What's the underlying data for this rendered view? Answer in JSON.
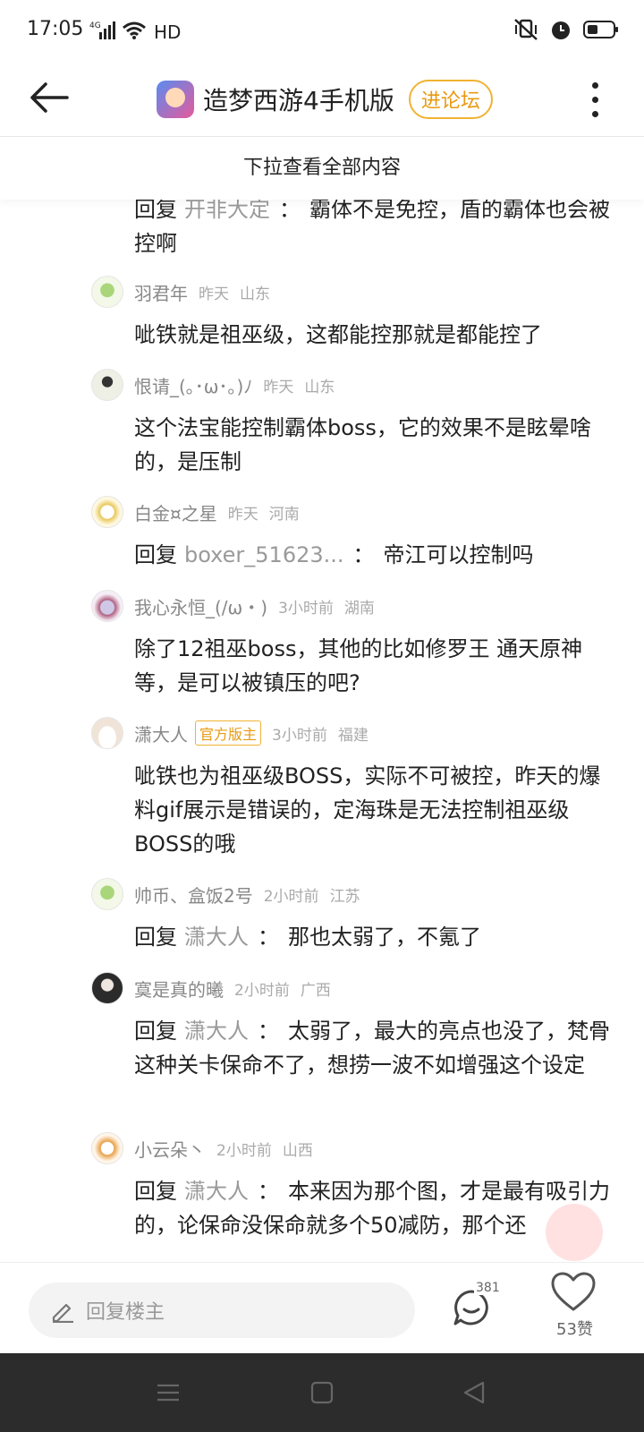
{
  "status_bar": {
    "time": "17:05",
    "network_label": "4G",
    "quality_label": "HD"
  },
  "nav": {
    "title": "造梦西游4手机版",
    "forum_button": "进论坛"
  },
  "pull_hint": "下拉查看全部内容",
  "comments": [
    {
      "type": "reply",
      "reply_word": "回复",
      "reply_target": "开非大定",
      "text": "霸体不是免控，盾的霸体也会被控啊"
    },
    {
      "type": "comment",
      "user": "羽君年",
      "time": "昨天",
      "region": "山东",
      "text": "呲铁就是祖巫级，这都能控那就是都能控了"
    },
    {
      "type": "comment",
      "user": "恨请_(｡･ω･｡)ﾉ",
      "time": "昨天",
      "region": "山东",
      "text": "这个法宝能控制霸体boss，它的效果不是眩晕啥的，是压制"
    },
    {
      "type": "comment",
      "user": "白金¤之星",
      "time": "昨天",
      "region": "河南",
      "reply_word": "回复",
      "reply_target": "boxer_51623...",
      "text": "帝江可以控制吗"
    },
    {
      "type": "comment",
      "user": "我心永恒_(/ω・)",
      "time": "3小时前",
      "region": "湖南",
      "text": "除了12祖巫boss，其他的比如修罗王 通天原神等，是可以被镇压的吧?"
    },
    {
      "type": "comment",
      "user": "潇大人",
      "badge": "官方版主",
      "time": "3小时前",
      "region": "福建",
      "text": "呲铁也为祖巫级BOSS，实际不可被控，昨天的爆料gif展示是错误的，定海珠是无法控制祖巫级BOSS的哦"
    },
    {
      "type": "comment",
      "user": "帅币、盒饭2号",
      "time": "2小时前",
      "region": "江苏",
      "reply_word": "回复",
      "reply_target": "潇大人",
      "text": "那也太弱了，不氪了"
    },
    {
      "type": "comment",
      "user": "寞是真的曦",
      "time": "2小时前",
      "region": "广西",
      "reply_word": "回复",
      "reply_target": "潇大人",
      "text": "太弱了，最大的亮点也没了，梵骨这种关卡保命不了，想捞一波不如增强这个设定"
    },
    {
      "type": "comment",
      "user": "小云朵丶",
      "time": "2小时前",
      "region": "山西",
      "reply_word": "回复",
      "reply_target": "潇大人",
      "text": "本来因为那个图，才是最有吸引力的，论保命没保命就多个50减防，那个还"
    }
  ],
  "bottom_bar": {
    "reply_placeholder": "回复楼主",
    "comment_count": "381",
    "like_label": "53赞"
  },
  "colors": {
    "accent": "#f1b233",
    "muted_text": "#888888",
    "system_nav_bg": "#2c2c2c"
  }
}
